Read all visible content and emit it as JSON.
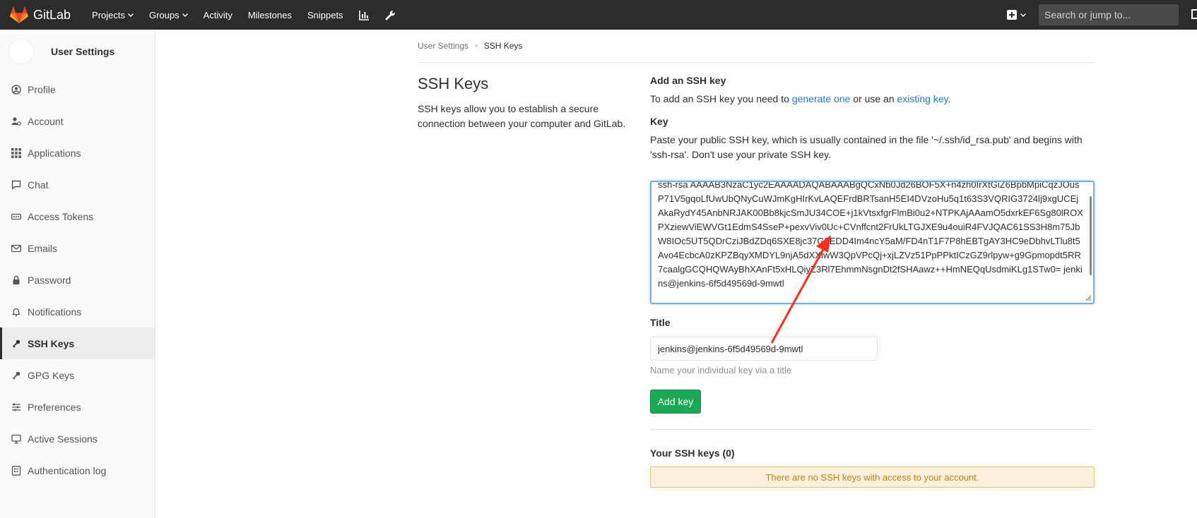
{
  "navbar": {
    "brand": "GitLab",
    "links": [
      {
        "label": "Projects",
        "dropdown": true
      },
      {
        "label": "Groups",
        "dropdown": true
      },
      {
        "label": "Activity",
        "dropdown": false
      },
      {
        "label": "Milestones",
        "dropdown": false
      },
      {
        "label": "Snippets",
        "dropdown": false
      }
    ],
    "icons": [
      "chart-icon",
      "wrench-icon"
    ],
    "search_placeholder": "Search or jump to..."
  },
  "sidebar": {
    "title": "User Settings",
    "items": [
      {
        "label": "Profile",
        "icon": "profile-icon"
      },
      {
        "label": "Account",
        "icon": "account-icon"
      },
      {
        "label": "Applications",
        "icon": "applications-icon"
      },
      {
        "label": "Chat",
        "icon": "chat-icon"
      },
      {
        "label": "Access Tokens",
        "icon": "token-icon"
      },
      {
        "label": "Emails",
        "icon": "email-icon"
      },
      {
        "label": "Password",
        "icon": "lock-icon"
      },
      {
        "label": "Notifications",
        "icon": "bell-icon"
      },
      {
        "label": "SSH Keys",
        "icon": "key-icon",
        "active": true
      },
      {
        "label": "GPG Keys",
        "icon": "key-icon"
      },
      {
        "label": "Preferences",
        "icon": "sliders-icon"
      },
      {
        "label": "Active Sessions",
        "icon": "monitor-icon"
      },
      {
        "label": "Authentication log",
        "icon": "log-icon"
      }
    ]
  },
  "breadcrumb": {
    "parent": "User Settings",
    "current": "SSH Keys"
  },
  "intro": {
    "title": "SSH Keys",
    "description": "SSH keys allow you to establish a secure connection between your computer and GitLab."
  },
  "form": {
    "heading": "Add an SSH key",
    "instructions_prefix": "To add an SSH key you need to ",
    "generate_link": "generate one",
    "instructions_middle": " or use an ",
    "existing_link": "existing key",
    "instructions_suffix": ".",
    "key_label": "Key",
    "key_help": "Paste your public SSH key, which is usually contained in the file '~/.ssh/id_rsa.pub' and begins with 'ssh-rsa'. Don't use your private SSH key.",
    "key_value": "ssh-rsa AAAAB3NzaC1yc2EAAAADAQABAAABgQCxNb0Jd26BOF5X+n4zh0IrXtGiZ6BpbMpiCqzJOusP71V5gqoLfUwUbQNyCuWJmKgHIrKvLAQEFrdBRTsanH5EI4DVzoHu5q1t63S3VQRIG3724lj9xgUCEjAkaRydY45AnbNRJAK00Bb8kjcSmJU34COE+j1kVtsxfgrFlmBi0u2+NTPKAjAAamO5dxrkEF6Sg80lROXPXziewViEWVGt1EdmS4SseP+pexvViv0Uc+CVnffcnt2FrUkLTGJXE9u4ouiR4FVJQAC61SS3H8m75JbW8IOc5UT5QDrCziJBdZDq6SXE8jc37G8EDD4Im4ncY5aM/FD4nT1F7P8hEBTgAY3HC9eDbhvLTlu8t5Avo4EcbcA0zKPZBqyXMDYL9njA5dXXlwW3QpVPcQj+xjLZVz51PpPPktICzGZ9rlpyw+g9Gpmopdt5RR7caalgGCQHQWAyBhXAnFt5xHLQiyZ3Rl7EhmmNsgnDt2fSHAawz++HmNEQqUsdmiKLg1STw0= jenkins@jenkins-6f5d49569d-9mwtl",
    "title_label": "Title",
    "title_value": "jenkins@jenkins-6f5d49569d-9mwtl",
    "title_help": "Name your individual key via a title",
    "submit_label": "Add key"
  },
  "keys_list": {
    "heading": "Your SSH keys (0)",
    "empty_message": "There are no SSH keys with access to your account."
  },
  "colors": {
    "navbar_bg": "#2c2c2c",
    "link": "#1f78d1",
    "button_green": "#1aaa55",
    "warning_bg": "#fdf1dd",
    "warning_text": "#c67e0f",
    "annotation_arrow": "#ff2d1a"
  }
}
